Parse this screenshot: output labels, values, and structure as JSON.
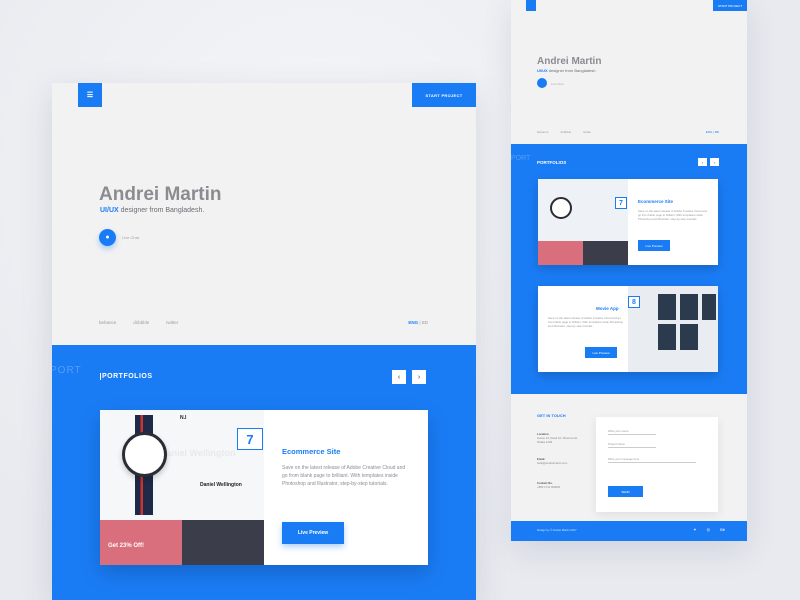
{
  "header": {
    "start_project": "START PROJECT",
    "menu_icon": "menu-icon"
  },
  "hero": {
    "name": "Andrei Martin",
    "role_highlight": "UI/UX",
    "role_rest": " designer from Bangladesh.",
    "chat_label": "Live Chat"
  },
  "social": [
    "behance",
    "dribbble",
    "twitter"
  ],
  "language": {
    "active": "ENG",
    "other": " | BD"
  },
  "portfolio": {
    "bg_text": "PORT",
    "title": "PORTFOLIOS",
    "prev": "‹",
    "next": "›",
    "card": {
      "number": "7",
      "title": "Ecommerce Site",
      "description": "Save on the latest release of Adobe Creative Cloud and go from blank page to brilliant. With templates inside Photoshop and Illustrator, step-by-step tutorials.",
      "button": "Live Preview",
      "shot_brand": "N.I",
      "shot_product": "Daniel Wellington",
      "shot_bg_text": "Daniel Wellington",
      "shot_offer": "Get 23% Off!"
    }
  },
  "right": {
    "start_project": "START PROJECT",
    "name": "Andrei Martin",
    "role_highlight": "UI/UX",
    "role_rest": " designer from Bangladesh",
    "chat_label": "Live Chat",
    "social": [
      "behance",
      "dribbble",
      "twitter"
    ],
    "language": "ENG | BD",
    "portfolio_title": "PORTFOLIOS",
    "portfolio_bg": "PORT",
    "cards": [
      {
        "number": "7",
        "title": "Ecommerce Site",
        "description": "Save on the latest release of Adobe Creative Cloud and go from blank page to brilliant. With templates inside Photoshop and Illustrator, step-by-step tutorials.",
        "button": "Live Preview"
      },
      {
        "number": "8",
        "title": "Movie App",
        "description": "Save on the latest release of Adobe Creative Cloud and go from blank page to brilliant. With templates inside Photoshop and Illustrator, step-by-step tutorials.",
        "button": "Live Preview"
      }
    ],
    "contact": {
      "title": "GET IN TOUCH",
      "location_label": "Location",
      "location_value": "House 12, Road 10, Dhanmondi, Dhaka 1209",
      "email_label": "Email",
      "email_value": "hello@andreimartin.com",
      "phone_label": "Contact No.",
      "phone_value": "+880 1711 000000",
      "form_name": "Write your name",
      "form_subject": "Project Name",
      "form_message": "Write your message here",
      "send": "SEND"
    },
    "footer": {
      "text": "Design by © Andrei Martin 2017"
    }
  },
  "colors": {
    "accent": "#1a7cf5",
    "bg": "#f2f2f3"
  }
}
